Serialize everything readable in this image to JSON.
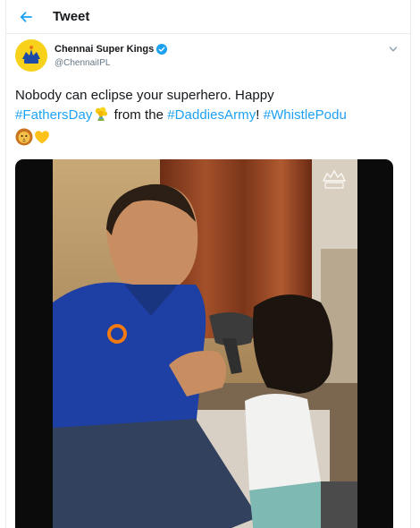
{
  "header": {
    "title": "Tweet"
  },
  "tweet": {
    "author": {
      "name": "Chennai Super Kings",
      "handle": "@ChennaiIPL"
    },
    "text_parts": {
      "t1": "Nobody can eclipse your superhero. Happy",
      "h1": "#FathersDay",
      "t2": " from the ",
      "h2": "#DaddiesArmy",
      "t3": "! ",
      "h3": "#WhistlePodu"
    }
  },
  "icons": {
    "back": "back-arrow-icon",
    "verified": "verified-badge-icon",
    "caret": "chevron-down-icon",
    "emoji1": "yellow-bouquet-emoji",
    "emoji2": "lion-face-emoji",
    "emoji3": "yellow-heart-emoji"
  },
  "colors": {
    "link": "#1da1f2",
    "text": "#14171a",
    "secondary": "#657786",
    "brand_yellow": "#f8d21a"
  }
}
